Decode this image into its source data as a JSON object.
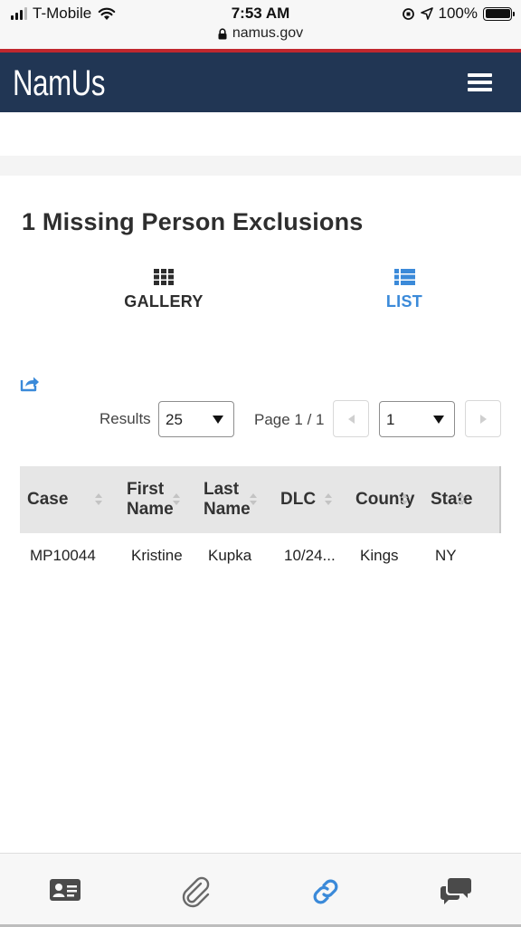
{
  "status_bar": {
    "carrier": "T-Mobile",
    "time": "7:53 AM",
    "battery": "100%",
    "url": "namus.gov"
  },
  "header": {
    "brand": "NamUs",
    "menu_icon": "hamburger-menu-icon"
  },
  "main": {
    "title": "1 Missing Person Exclusions",
    "views": [
      {
        "label": "GALLERY",
        "icon": "grid-icon",
        "active": false
      },
      {
        "label": "LIST",
        "icon": "list-icon",
        "active": true
      }
    ],
    "share_icon": "share-icon",
    "pagination": {
      "results_label": "Results",
      "results_value": "25",
      "page_label": "Page 1 / 1",
      "page_value": "1"
    },
    "table": {
      "columns": [
        "Case",
        "First Name",
        "Last Name",
        "DLC",
        "County",
        "State"
      ],
      "rows": [
        {
          "case": "MP10044",
          "first_name": "Kristine",
          "last_name": "Kupka",
          "dlc": "10/24...",
          "county": "Kings",
          "state": "NY"
        }
      ]
    }
  },
  "bottom_tabs": [
    {
      "icon": "contact-card-icon"
    },
    {
      "icon": "paperclip-icon"
    },
    {
      "icon": "link-icon",
      "active": true
    },
    {
      "icon": "chat-bubbles-icon"
    }
  ],
  "colors": {
    "navbar": "#213654",
    "accent_red": "#c0282e",
    "active_blue": "#3b8ad9",
    "table_header": "#e6e6e6"
  }
}
